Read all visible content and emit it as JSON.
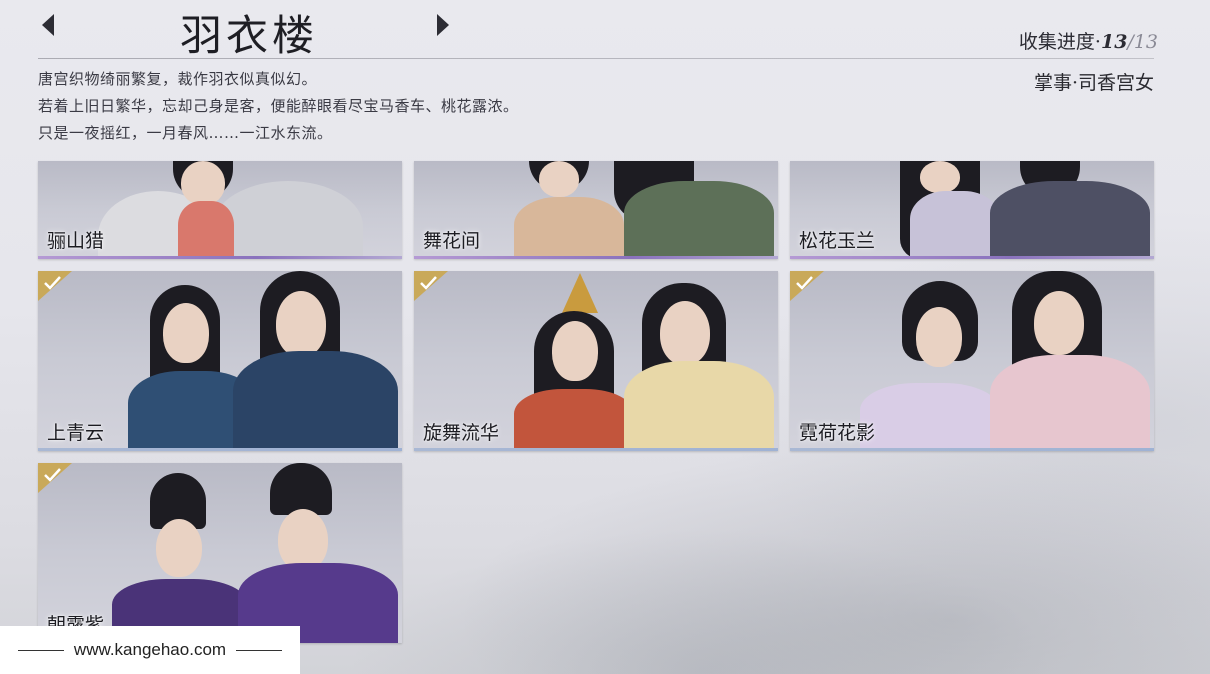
{
  "header": {
    "title": "羽衣楼",
    "progress_label": "收集进度·",
    "progress_current": "13",
    "progress_total": "/13"
  },
  "description": [
    "唐宫织物绮丽繁复，裁作羽衣似真似幻。",
    "若着上旧日繁华，忘却己身是客，便能醉眼看尽宝马香车、桃花露浓。",
    "只是一夜摇红，一月春风……一江水东流。"
  ],
  "reward": "掌事·司香宫女",
  "cards": [
    {
      "name": "骊山猎",
      "collected": false
    },
    {
      "name": "舞花间",
      "collected": false
    },
    {
      "name": "松花玉兰",
      "collected": false
    },
    {
      "name": "上青云",
      "collected": true
    },
    {
      "name": "旋舞流华",
      "collected": true
    },
    {
      "name": "霓荷花影",
      "collected": true
    },
    {
      "name": "朝露紫",
      "collected": true
    }
  ],
  "footer": {
    "url": "www.kangehao.com"
  },
  "colors": {
    "check_badge": "#c9a95a",
    "card_bar": "#7c62ad"
  }
}
